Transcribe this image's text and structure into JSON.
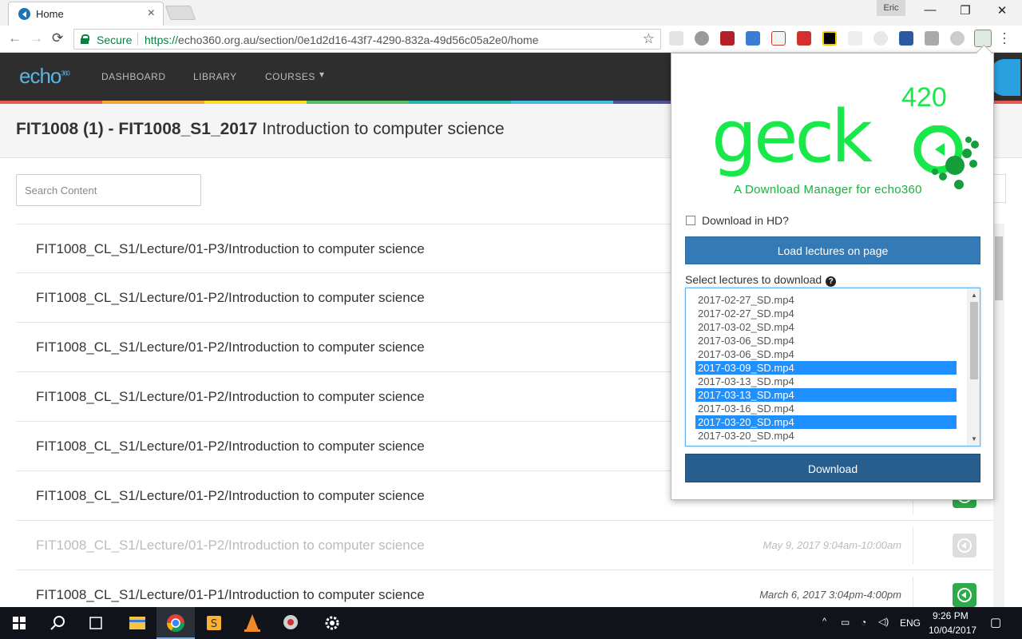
{
  "browser": {
    "tab_title": "Home",
    "tab_close": "×",
    "profile_name": "Eric",
    "secure_label": "Secure",
    "url_scheme": "https://",
    "url_rest": "echo360.org.au/section/0e1d2d16-43f7-4290-832a-49d56c05a2e0/home",
    "minimize": "—",
    "maximize": "❐",
    "close": "✕",
    "back": "←",
    "forward": "→",
    "reload": "⟳",
    "star": "☆"
  },
  "site": {
    "logo": "echo",
    "logo_sup": "360",
    "nav": [
      "DASHBOARD",
      "LIBRARY",
      "COURSES"
    ],
    "courses_caret": "▾"
  },
  "course": {
    "title_bold": "FIT1008 (1) - FIT1008_S1_2017",
    "title_rest": "Introduction to computer science",
    "search_placeholder": "Search Content"
  },
  "lectures": [
    {
      "title": "FIT1008_CL_S1/Lecture/01-P3/Introduction to computer science",
      "date": "",
      "time": "",
      "dim": false
    },
    {
      "title": "FIT1008_CL_S1/Lecture/01-P2/Introduction to computer science",
      "date": "",
      "time": "",
      "dim": false
    },
    {
      "title": "FIT1008_CL_S1/Lecture/01-P2/Introduction to computer science",
      "date": "",
      "time": "",
      "dim": false
    },
    {
      "title": "FIT1008_CL_S1/Lecture/01-P2/Introduction to computer science",
      "date": "",
      "time": "",
      "dim": false
    },
    {
      "title": "FIT1008_CL_S1/Lecture/01-P2/Introduction to computer science",
      "date": "",
      "time": "",
      "dim": false
    },
    {
      "title": "FIT1008_CL_S1/Lecture/01-P2/Introduction to computer science",
      "date": "",
      "time": "",
      "dim": false
    },
    {
      "title": "FIT1008_CL_S1/Lecture/01-P2/Introduction to computer science",
      "date": "May 9, 2017",
      "time": "9:04am-10:00am",
      "dim": true
    },
    {
      "title": "FIT1008_CL_S1/Lecture/01-P1/Introduction to computer science",
      "date": "March 6, 2017",
      "time": "3:04pm-4:00pm",
      "dim": false
    }
  ],
  "popup": {
    "logo_text": "geck",
    "logo_version": "420",
    "tagline": "A Download Manager for echo360",
    "hd_label": "Download in HD?",
    "hd_checked": false,
    "load_button": "Load lectures on page",
    "select_label": "Select lectures to download",
    "help_glyph": "?",
    "download_button": "Download",
    "options": [
      {
        "label": "2017-02-27_SD.mp4",
        "selected": false
      },
      {
        "label": "2017-02-27_SD.mp4",
        "selected": false
      },
      {
        "label": "2017-03-02_SD.mp4",
        "selected": false
      },
      {
        "label": "2017-03-06_SD.mp4",
        "selected": false
      },
      {
        "label": "2017-03-06_SD.mp4",
        "selected": false
      },
      {
        "label": "2017-03-09_SD.mp4",
        "selected": true
      },
      {
        "label": "2017-03-13_SD.mp4",
        "selected": false
      },
      {
        "label": "2017-03-13_SD.mp4",
        "selected": true
      },
      {
        "label": "2017-03-16_SD.mp4",
        "selected": false
      },
      {
        "label": "2017-03-20_SD.mp4",
        "selected": true
      },
      {
        "label": "2017-03-20_SD.mp4",
        "selected": false
      }
    ]
  },
  "taskbar": {
    "lang": "ENG",
    "time": "9:26 PM",
    "date": "10/04/2017"
  },
  "colors": {
    "accent_green": "#19e84a",
    "button_blue": "#337ab7",
    "download_blue": "#285e8e",
    "selection_blue": "#1e90ff",
    "play_green": "#2eaa4a"
  }
}
